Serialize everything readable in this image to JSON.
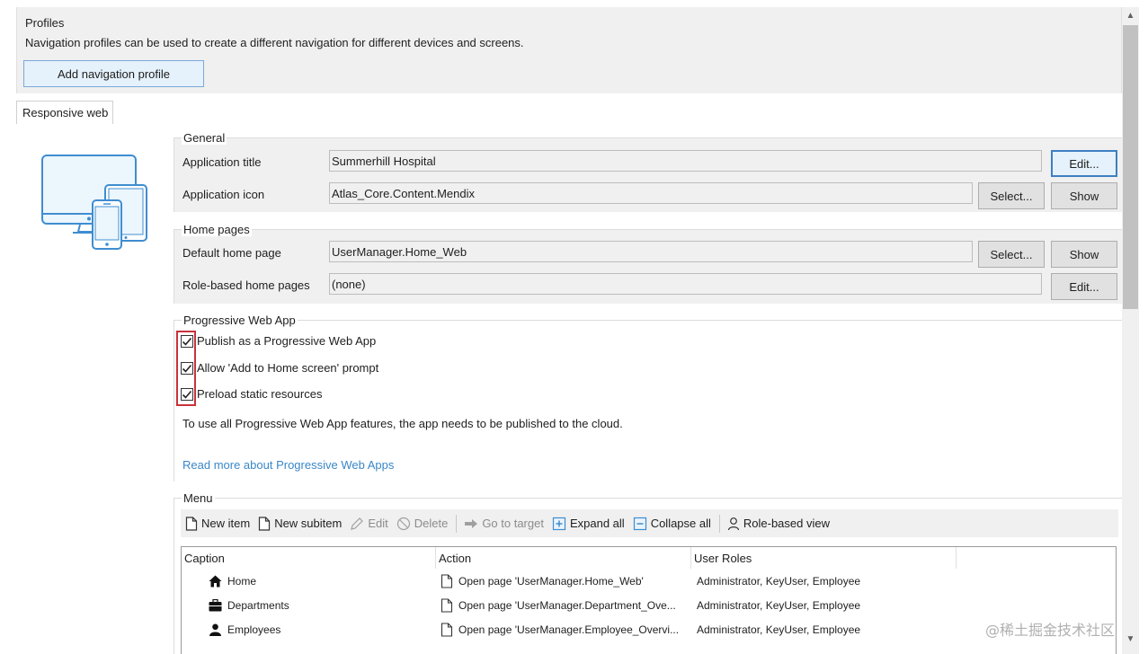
{
  "profiles": {
    "title": "Profiles",
    "description": "Navigation profiles can be used to create a different navigation for different devices and screens.",
    "add_button": "Add navigation profile"
  },
  "tab": {
    "label": "Responsive web"
  },
  "general": {
    "legend": "General",
    "app_title_label": "Application title",
    "app_title_value": "Summerhill Hospital",
    "app_title_edit": "Edit...",
    "app_icon_label": "Application icon",
    "app_icon_value": "Atlas_Core.Content.Mendix",
    "app_icon_select": "Select...",
    "app_icon_show": "Show"
  },
  "home_pages": {
    "legend": "Home pages",
    "default_label": "Default home page",
    "default_value": "UserManager.Home_Web",
    "default_select": "Select...",
    "default_show": "Show",
    "role_label": "Role-based home pages",
    "role_value": "(none)",
    "role_edit": "Edit..."
  },
  "pwa": {
    "legend": "Progressive Web App",
    "options": [
      {
        "label": "Publish as a Progressive Web App",
        "checked": true
      },
      {
        "label": "Allow 'Add to Home screen' prompt",
        "checked": true
      },
      {
        "label": "Preload static resources",
        "checked": true
      }
    ],
    "note": "To use all Progressive Web App features, the app needs to be published to the cloud.",
    "link": "Read more about Progressive Web Apps"
  },
  "menu": {
    "legend": "Menu",
    "toolbar": {
      "new_item": "New item",
      "new_subitem": "New subitem",
      "edit": "Edit",
      "delete": "Delete",
      "go_to_target": "Go to target",
      "expand_all": "Expand all",
      "collapse_all": "Collapse all",
      "role_based_view": "Role-based view"
    },
    "columns": [
      "Caption",
      "Action",
      "User Roles"
    ],
    "rows": [
      {
        "caption": "Home",
        "icon": "home-icon",
        "action": "Open page 'UserManager.Home_Web'",
        "roles": "Administrator, KeyUser, Employee"
      },
      {
        "caption": "Departments",
        "icon": "briefcase-icon",
        "action": "Open page 'UserManager.Department_Ove...",
        "roles": "Administrator, KeyUser, Employee"
      },
      {
        "caption": "Employees",
        "icon": "person-icon",
        "action": "Open page 'UserManager.Employee_Overvi...",
        "roles": "Administrator, KeyUser, Employee"
      }
    ]
  },
  "watermark": "@稀土掘金技术社区",
  "colors": {
    "accent": "#3c7fc2",
    "link": "#3a87c8",
    "highlight": "#c8323c"
  }
}
